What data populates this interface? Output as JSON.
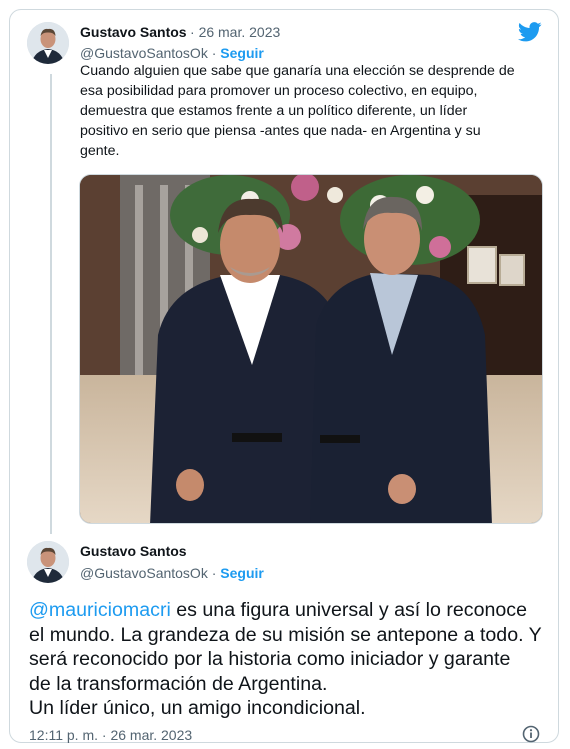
{
  "tweet1": {
    "author_name": "Gustavo Santos",
    "date_sep": "·",
    "date": "26 mar. 2023",
    "handle": "@GustavoSantosOk",
    "handle_sep": "·",
    "follow_label": "Seguir",
    "text_lines": [
      "Cuando alguien que sabe que ganaría una elección se desprende de",
      "esa posibilidad para promover un proceso colectivo, en equipo,",
      "demuestra que estamos frente a un político diferente, un líder",
      "positivo en serio que piensa -antes que nada- en Argentina y su",
      "gente."
    ]
  },
  "tweet2": {
    "author_name": "Gustavo Santos",
    "handle": "@GustavoSantosOk",
    "handle_sep": "·",
    "follow_label": "Seguir",
    "mention": "@mauriciomacri",
    "text_first_rest": " es una figura universal y así lo reconoce",
    "text_lines": [
      "el mundo. La grandeza de su misión se antepone a todo. Y",
      "será reconocido por la historia como iniciador y garante",
      "de la transformación de Argentina.",
      "Un líder único, un amigo incondicional."
    ],
    "timestamp": "12:11 p. m. · 26 mar. 2023"
  },
  "icons": {
    "brand": "twitter-bird-icon",
    "info": "info-icon"
  },
  "colors": {
    "accent": "#1d9bf0",
    "text": "#0f1419",
    "muted": "#536471",
    "border": "#cfd9de"
  }
}
